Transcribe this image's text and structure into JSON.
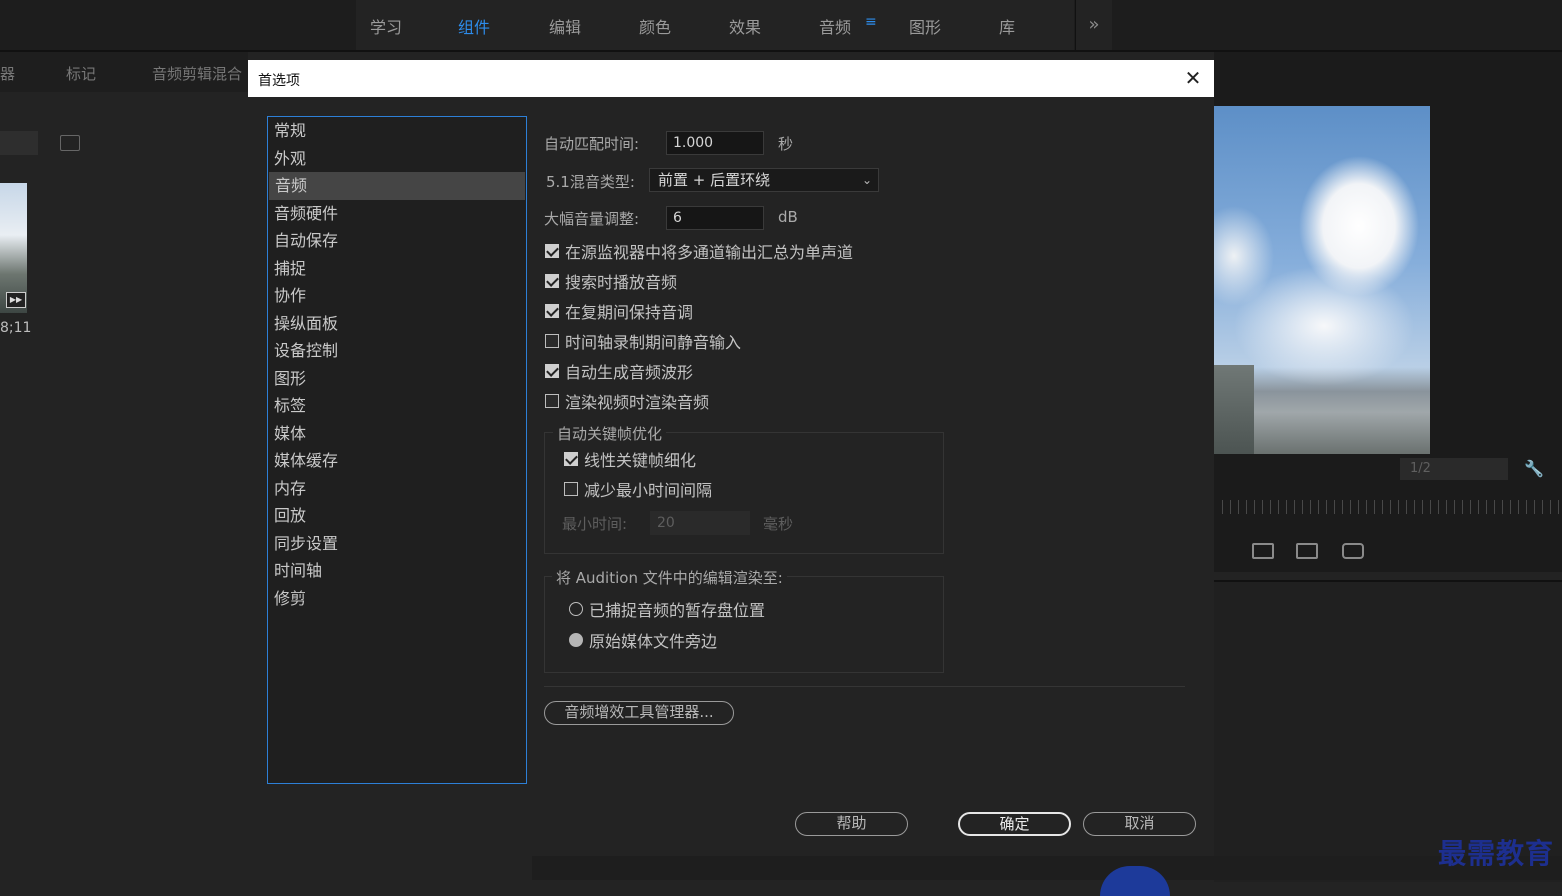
{
  "workspace_tabs": [
    "学习",
    "组件",
    "编辑",
    "颜色",
    "效果",
    "音频",
    "图形",
    "库"
  ],
  "workspace_menu_glyph": "≡",
  "workspace_more_glyph": "»",
  "bg_left": {
    "tab_partial": "器",
    "tab_markers": "标记",
    "tab_mixer": "音频剪辑混合",
    "timecode": "8;11"
  },
  "bg_right": {
    "zoom_value": "1/2"
  },
  "logo_text": "最需教育",
  "dialog": {
    "title": "首选项",
    "close_glyph": "✕",
    "categories": [
      "常规",
      "外观",
      "音频",
      "音频硬件",
      "自动保存",
      "捕捉",
      "协作",
      "操纵面板",
      "设备控制",
      "图形",
      "标签",
      "媒体",
      "媒体缓存",
      "内存",
      "回放",
      "同步设置",
      "时间轴",
      "修剪"
    ],
    "selected_category": "音频",
    "automatch_label": "自动匹配时间:",
    "automatch_value": "1.000",
    "automatch_unit": "秒",
    "mix_label": "5.1混音类型:",
    "mix_value": "前置 + 后置环绕",
    "volume_label": "大幅音量调整:",
    "volume_value": "6",
    "volume_unit": "dB",
    "checkboxes": [
      {
        "label": "在源监视器中将多通道输出汇总为单声道",
        "checked": true
      },
      {
        "label": "搜索时播放音频",
        "checked": true
      },
      {
        "label": "在复期间保持音调",
        "checked": true
      },
      {
        "label": "时间轴录制期间静音输入",
        "checked": false
      },
      {
        "label": "自动生成音频波形",
        "checked": true
      },
      {
        "label": "渲染视频时渲染音频",
        "checked": false
      }
    ],
    "keyframe_group": {
      "title": "自动关键帧优化",
      "linear_label": "线性关键帧细化",
      "linear_checked": true,
      "reduce_label": "减少最小时间间隔",
      "reduce_checked": false,
      "min_time_label": "最小时间:",
      "min_time_value": "20",
      "min_time_unit": "毫秒"
    },
    "audition_group": {
      "title": "将 Audition 文件中的编辑渲染至:",
      "option1": "已捕捉音频的暂存盘位置",
      "option1_selected": false,
      "option2": "原始媒体文件旁边",
      "option2_selected": true
    },
    "plugin_manager_button": "音频增效工具管理器...",
    "help_button": "帮助",
    "ok_button": "确定",
    "cancel_button": "取消"
  }
}
